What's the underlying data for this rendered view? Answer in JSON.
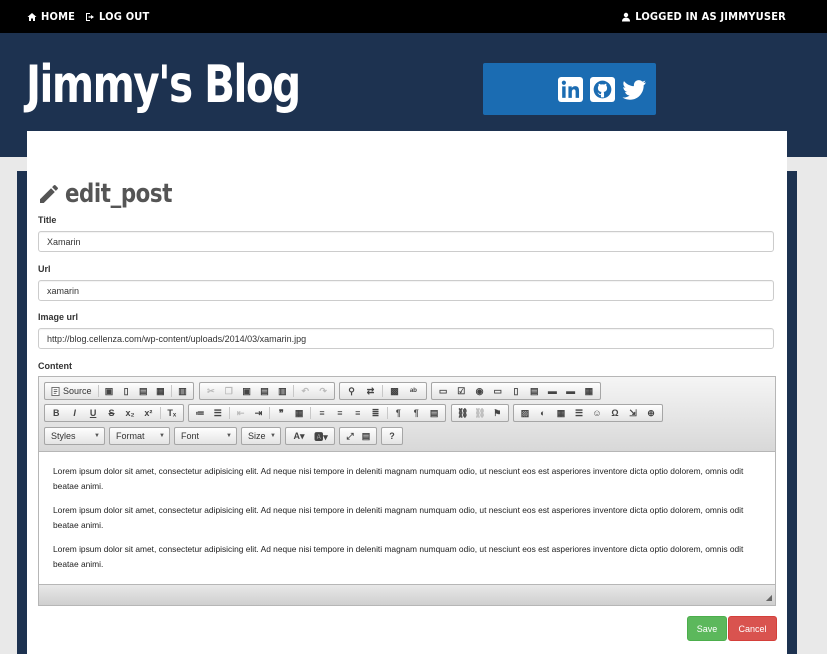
{
  "nav": {
    "home": "HOME",
    "logout": "LOG OUT",
    "user": "LOGGED IN AS JIMMYUSER"
  },
  "header": {
    "blog_title": "Jimmy's Blog",
    "social_color": "#1b6cb2",
    "social_icons": [
      "linkedin-icon",
      "github-icon",
      "twitter-icon"
    ]
  },
  "page": {
    "heading": "edit_post",
    "heading_icon": "pencil-icon"
  },
  "form": {
    "title_label": "Title",
    "title_value": "Xamarin",
    "url_label": "Url",
    "url_value": "xamarin",
    "image_label": "Image url",
    "image_value": "http://blog.cellenza.com/wp-content/uploads/2014/03/xamarin.jpg",
    "content_label": "Content"
  },
  "editor": {
    "source_label": "Source",
    "combos": {
      "styles": "Styles",
      "format": "Format",
      "font": "Font",
      "size": "Size"
    },
    "paragraphs": [
      "Lorem ipsum dolor sit amet, consectetur adipisicing elit. Ad neque nisi tempore in deleniti magnam numquam odio, ut nesciunt eos est asperiores inventore dicta optio dolorem, omnis odit beatae animi.",
      "Lorem ipsum dolor sit amet, consectetur adipisicing elit. Ad neque nisi tempore in deleniti magnam numquam odio, ut nesciunt eos est asperiores inventore dicta optio dolorem, omnis odit beatae animi.",
      "Lorem ipsum dolor sit amet, consectetur adipisicing elit. Ad neque nisi tempore in deleniti magnam numquam odio, ut nesciunt eos est asperiores inventore dicta optio dolorem, omnis odit beatae animi."
    ]
  },
  "actions": {
    "save": "Save",
    "cancel": "Cancel"
  },
  "colors": {
    "header_bg": "#1d3250",
    "save": "#5cb85c",
    "cancel": "#d9534f"
  }
}
